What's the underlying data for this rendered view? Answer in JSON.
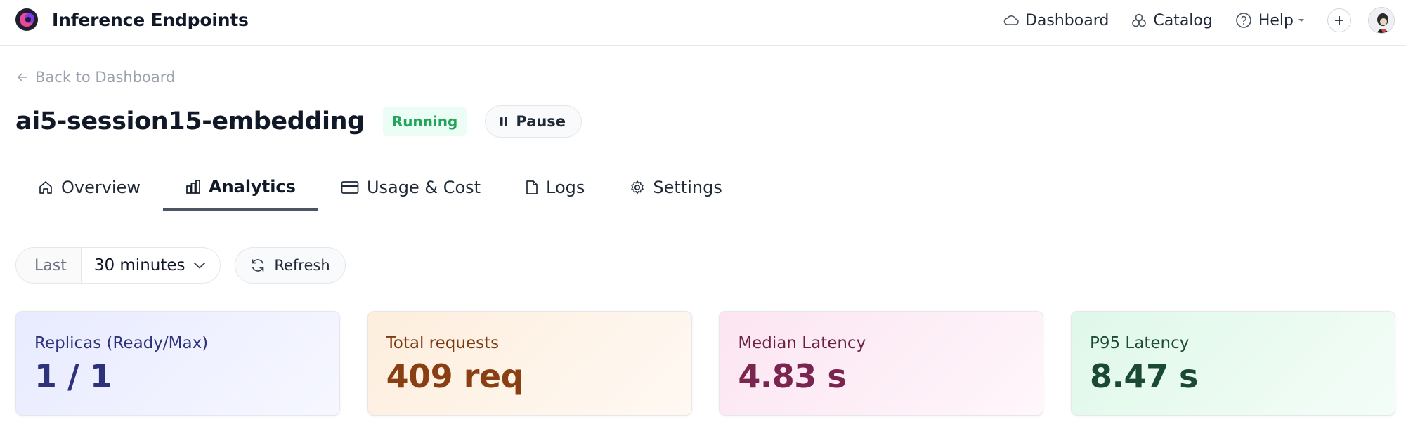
{
  "app": {
    "title": "Inference Endpoints"
  },
  "topnav": {
    "dashboard": "Dashboard",
    "catalog": "Catalog",
    "help": "Help"
  },
  "back_link": "Back to Dashboard",
  "endpoint": {
    "name": "ai5-session15-embedding",
    "status": "Running",
    "pause_label": "Pause"
  },
  "tabs": [
    {
      "label": "Overview",
      "icon": "home-icon",
      "active": false
    },
    {
      "label": "Analytics",
      "icon": "chart-icon",
      "active": true
    },
    {
      "label": "Usage & Cost",
      "icon": "credit-card-icon",
      "active": false
    },
    {
      "label": "Logs",
      "icon": "file-icon",
      "active": false
    },
    {
      "label": "Settings",
      "icon": "gear-icon",
      "active": false
    }
  ],
  "controls": {
    "range_prefix": "Last",
    "range_value": "30 minutes",
    "refresh_label": "Refresh"
  },
  "metrics": [
    {
      "label": "Replicas (Ready/Max)",
      "value": "1 / 1",
      "color": "#2e3278"
    },
    {
      "label": "Total requests",
      "value": "409 req",
      "color": "#8a3f12"
    },
    {
      "label": "Median Latency",
      "value": "4.83 s",
      "color": "#7a2450"
    },
    {
      "label": "P95 Latency",
      "value": "8.47 s",
      "color": "#1a4a35"
    }
  ],
  "colors": {
    "running_green": "#22a55a",
    "brand_purple": "#6d28d9"
  }
}
